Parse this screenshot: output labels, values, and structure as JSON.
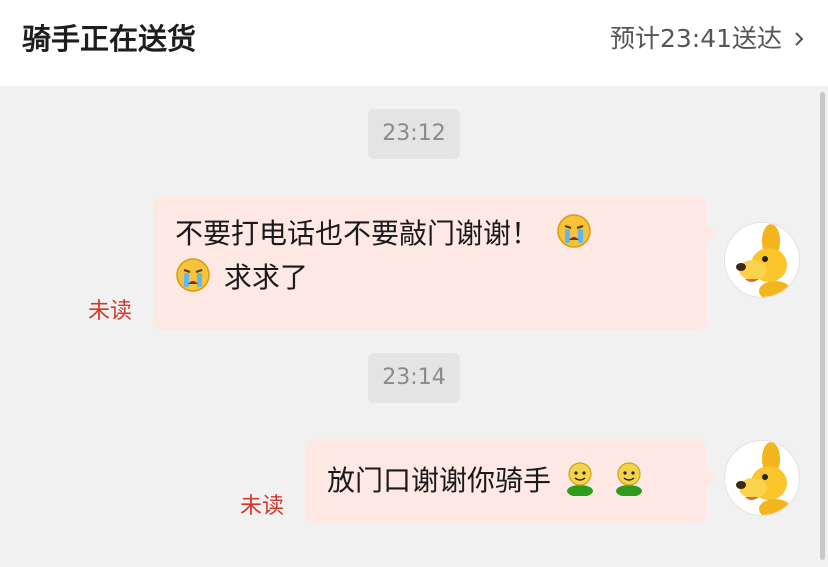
{
  "header": {
    "title": "骑手正在送货",
    "eta": "预计23:41送达",
    "chevron_icon": "chevron-right-icon"
  },
  "messages": [
    {
      "time": "23:12",
      "text_line1": "不要打电话也不要敲门谢谢！",
      "text_line2": "求求了",
      "emoji": "crying-face-icon",
      "status": "未读"
    },
    {
      "time": "23:14",
      "text": "放门口谢谢你骑手",
      "emoji": "green-smiley-icon",
      "status": "未读"
    }
  ],
  "avatar_icon": "yellow-dog-avatar-icon",
  "colors": {
    "bubble": "#fde8e4",
    "unread": "#d2382b",
    "background": "#f1f1f1"
  }
}
